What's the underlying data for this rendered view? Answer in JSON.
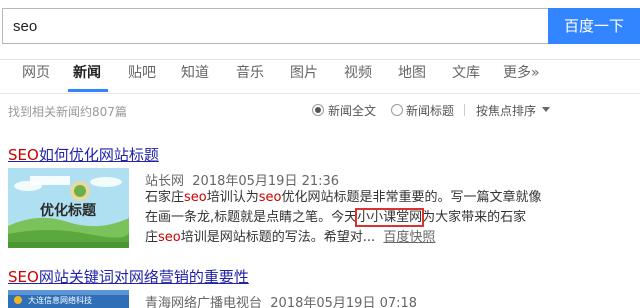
{
  "search": {
    "query": "seo",
    "button_label": "百度一下"
  },
  "tabs": [
    {
      "label": "网页"
    },
    {
      "label": "新闻"
    },
    {
      "label": "贴吧"
    },
    {
      "label": "知道"
    },
    {
      "label": "音乐"
    },
    {
      "label": "图片"
    },
    {
      "label": "视频"
    },
    {
      "label": "地图"
    },
    {
      "label": "文库"
    },
    {
      "label": "更多»"
    }
  ],
  "options": {
    "result_count": "找到相关新闻约807篇",
    "full_text_label": "新闻全文",
    "title_label": "新闻标题",
    "sort_label": "按焦点排序"
  },
  "results": [
    {
      "title_hl": "SEO",
      "title_rest": "如何优化网站标题",
      "thumb_text": "优化标题",
      "source": "站长网",
      "date": "2018年05月19日 21:36",
      "snippet_1a": "石家庄",
      "snippet_1b": "seo",
      "snippet_1c": "培训认为",
      "snippet_1d": "seo",
      "snippet_1e": "优化网站标题是非常重要的。写一篇文章就像",
      "snippet_2a": "在画一条龙,标题就是点睛之笔。今天",
      "snippet_2b": "小小课堂网",
      "snippet_2c": "为大家带来的石家",
      "snippet_3a": "庄",
      "snippet_3b": "seo",
      "snippet_3c": "培训是网站标题的写法。希望对...",
      "cache_label": "百度快照"
    },
    {
      "title_hl": "SEO",
      "title_rest": "网站关键词对网络营销的重要性",
      "thumb_text": "大连信息网络科技",
      "source": "青海网络广播电视台",
      "date": "2018年05月19日 07:18"
    }
  ],
  "colors": {
    "accent": "#3385ff",
    "link": "#2222aa",
    "highlight": "#cc0000",
    "box": "#d9332f"
  }
}
